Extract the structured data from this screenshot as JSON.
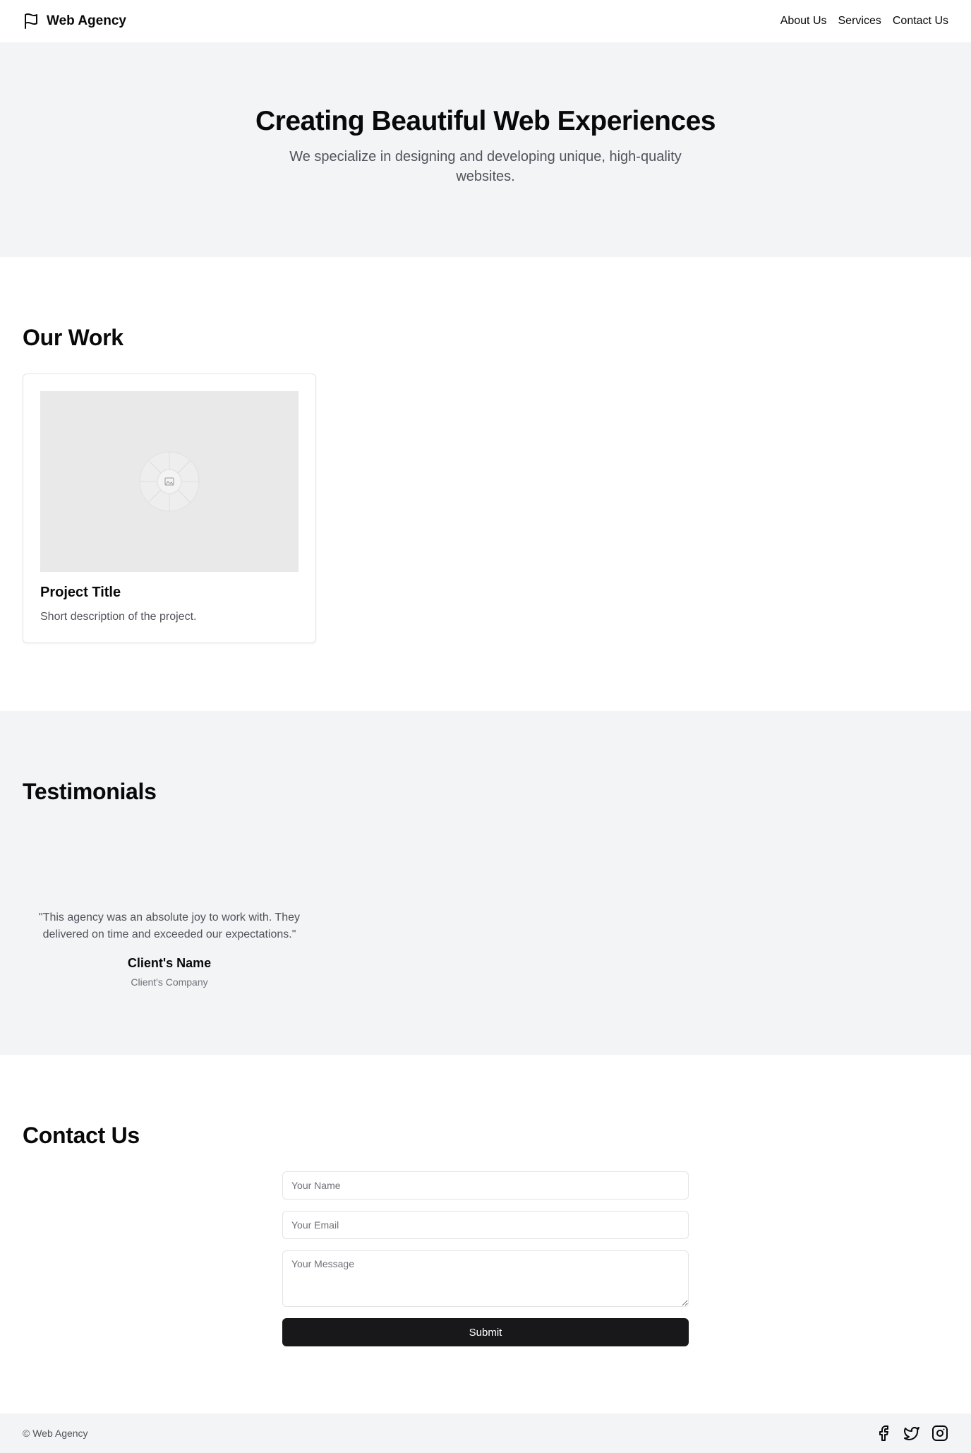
{
  "header": {
    "brand": "Web Agency",
    "nav": [
      "About Us",
      "Services",
      "Contact Us"
    ]
  },
  "hero": {
    "title": "Creating Beautiful Web Experiences",
    "subtitle": "We specialize in designing and developing unique, high-quality websites."
  },
  "work": {
    "title": "Our Work",
    "projects": [
      {
        "title": "Project Title",
        "description": "Short description of the project.",
        "image_icon": "image-placeholder-icon"
      }
    ]
  },
  "testimonials": {
    "title": "Testimonials",
    "items": [
      {
        "quote": "\"This agency was an absolute joy to work with. They delivered on time and exceeded our expectations.\"",
        "name": "Client's Name",
        "company": "Client's Company"
      }
    ]
  },
  "contact": {
    "title": "Contact Us",
    "name_placeholder": "Your Name",
    "email_placeholder": "Your Email",
    "message_placeholder": "Your Message",
    "submit_label": "Submit"
  },
  "footer": {
    "copyright": "© Web Agency",
    "social_icons": [
      "facebook-icon",
      "twitter-icon",
      "instagram-icon"
    ]
  },
  "colors": {
    "section_bg": "#f3f4f6",
    "primary_button": "#18181b",
    "muted_text": "#52525b"
  }
}
